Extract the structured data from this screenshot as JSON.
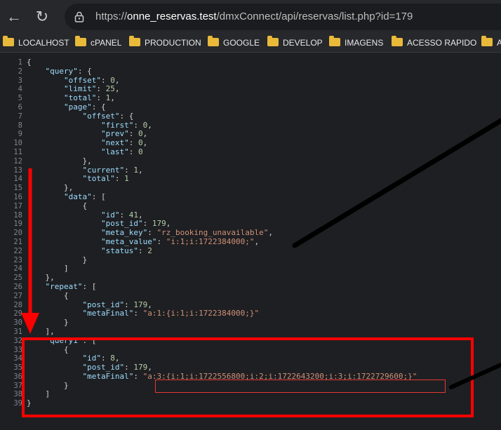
{
  "browser": {
    "url_host": "onne_reservas.test",
    "url_path": "/dmxConnect/api/reservas/list.php?id=179",
    "url_scheme": "https://"
  },
  "bookmarks": [
    {
      "label": "LOCALHOST"
    },
    {
      "label": "cPANEL"
    },
    {
      "label": "PRODUCTION"
    },
    {
      "label": "GOOGLE"
    },
    {
      "label": "DEVELOP"
    },
    {
      "label": "IMAGENS"
    },
    {
      "label": "ACESSO RAPIDO"
    },
    {
      "label": "A"
    }
  ],
  "line_numbers": [
    "1",
    "2",
    "3",
    "4",
    "5",
    "6",
    "7",
    "8",
    "9",
    "10",
    "11",
    "12",
    "13",
    "14",
    "15",
    "16",
    "17",
    "18",
    "19",
    "20",
    "21",
    "22",
    "23",
    "24",
    "25",
    "26",
    "27",
    "28",
    "29",
    "30",
    "31",
    "32",
    "33",
    "34",
    "35",
    "36",
    "37",
    "38",
    "39"
  ],
  "json": {
    "query_key": "\"query\"",
    "offset_key": "\"offset\"",
    "offset_val": "0",
    "limit_key": "\"limit\"",
    "limit_val": "25",
    "total_key": "\"total\"",
    "total_val": "1",
    "page_key": "\"page\"",
    "first_key": "\"first\"",
    "first_val": "0",
    "prev_key": "\"prev\"",
    "prev_val": "0",
    "next_key": "\"next\"",
    "next_val": "0",
    "last_key": "\"last\"",
    "last_val": "0",
    "current_key": "\"current\"",
    "current_val": "1",
    "ptotal_key": "\"total\"",
    "ptotal_val": "1",
    "data_key": "\"data\"",
    "id_key": "\"id\"",
    "id_val": "41",
    "post_id_key": "\"post_id\"",
    "post_id_val": "179",
    "meta_key_key": "\"meta_key\"",
    "meta_key_val": "\"rz_booking_unavailable\"",
    "meta_value_key": "\"meta_value\"",
    "meta_value_val": "\"i:1;i:1722384000;\"",
    "status_key": "\"status\"",
    "status_val": "2",
    "repeat_key": "\"repeat\"",
    "r_post_id_key": "\"post_id\"",
    "r_post_id_val": "179",
    "r_metafinal_key": "\"metaFinal\"",
    "r_metafinal_val": "\"a:1:{i:1;i:1722384000;}\"",
    "query1_key": "\"query1\"",
    "q1_id_key": "\"id\"",
    "q1_id_val": "8",
    "q1_post_id_key": "\"post_id\"",
    "q1_post_id_val": "179",
    "q1_metafinal_key": "\"metaFinal\"",
    "q1_metafinal_val": "\"a:3:{i:1;i:1722556800;i:2;i:1722643200;i:3;i:1722729600;}\""
  },
  "colors": {
    "highlight": "#ff0000",
    "key": "#9cdcfe",
    "number": "#b5cea8",
    "string": "#ce9178"
  }
}
